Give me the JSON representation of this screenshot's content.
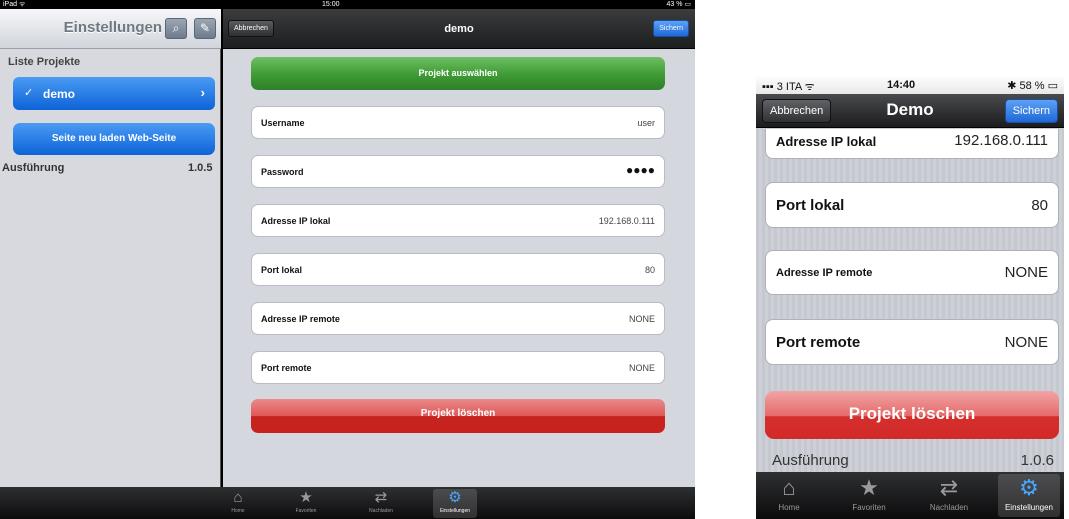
{
  "ipad": {
    "status": {
      "carrier": "iPad ᯤ",
      "time": "15:00",
      "battery": "43 % ▭"
    },
    "master": {
      "title": "Einstellungen",
      "search_icon": "search-icon",
      "compose_icon": "compose-icon",
      "section_header": "Liste Projekte",
      "project": {
        "check": "✓",
        "name": "demo",
        "chevron": "›"
      },
      "reload_button": "Seite neu laden Web-Seite",
      "version_label": "Ausführung",
      "version_value": "1.0.5"
    },
    "detail": {
      "cancel": "Abbrechen",
      "title": "demo",
      "save": "Sichern",
      "select_button": "Projekt auswählen",
      "fields": [
        {
          "label": "Username",
          "value": "user"
        },
        {
          "label": "Password",
          "value": "●●●●"
        },
        {
          "label": "Adresse IP lokal",
          "value": "192.168.0.111"
        },
        {
          "label": "Port lokal",
          "value": "80"
        },
        {
          "label": "Adresse IP remote",
          "value": "NONE"
        },
        {
          "label": "Port remote",
          "value": "NONE"
        }
      ],
      "delete_button": "Projekt löschen"
    },
    "tabs": [
      {
        "icon": "home-icon",
        "glyph": "⌂",
        "label": "Home"
      },
      {
        "icon": "star-icon",
        "glyph": "★",
        "label": "Favoriten"
      },
      {
        "icon": "reload-icon",
        "glyph": "⇄",
        "label": "Nachladen"
      },
      {
        "icon": "gear-icon",
        "glyph": "⚙",
        "label": "Einstellungen",
        "active": true
      }
    ]
  },
  "iphone": {
    "status": {
      "carrier": "▪▪▪ 3 ITA ᯤ",
      "time": "14:40",
      "battery": "✱ 58 % ▭"
    },
    "cancel": "Abbrechen",
    "title": "Demo",
    "save": "Sichern",
    "fields": [
      {
        "label": "Adresse IP lokal",
        "value": "192.168.0.111"
      },
      {
        "label": "Port lokal",
        "value": "80"
      },
      {
        "label": "Adresse IP remote",
        "value": "NONE"
      },
      {
        "label": "Port remote",
        "value": "NONE"
      }
    ],
    "delete_button": "Projekt löschen",
    "version_label": "Ausführung",
    "version_value": "1.0.6",
    "tabs": [
      {
        "icon": "home-icon",
        "glyph": "⌂",
        "label": "Home"
      },
      {
        "icon": "star-icon",
        "glyph": "★",
        "label": "Favoriten"
      },
      {
        "icon": "reload-icon",
        "glyph": "⇄",
        "label": "Nachladen"
      },
      {
        "icon": "gear-icon",
        "glyph": "⚙",
        "label": "Einstellungen",
        "active": true
      }
    ]
  },
  "colors": {
    "accent_blue": "#1e69d9",
    "select_green": "#3d9a33",
    "delete_red": "#c9221e"
  }
}
